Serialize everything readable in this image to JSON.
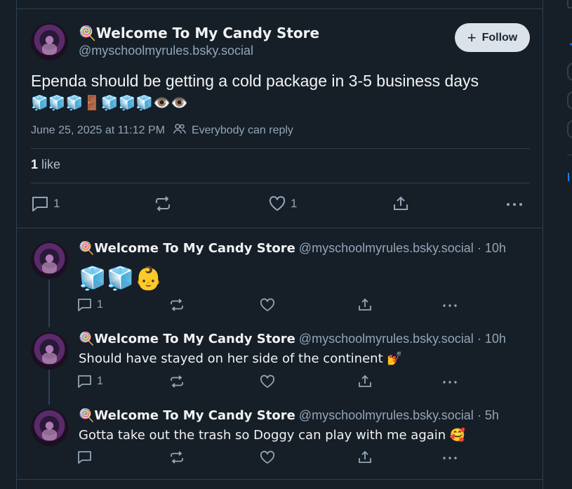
{
  "main_post": {
    "display_name": "🍭Welcome To My Candy Store",
    "handle": "@myschoolmyrules.bsky.social",
    "follow_label": "Follow",
    "text_line1": "Ependa should be getting a cold package in 3-5 business days",
    "text_line2": "🧊🧊🧊🚪🧊🧊🧊👁️👁️",
    "timestamp": "June 25, 2025 at 11:12 PM",
    "reply_setting": "Everybody can reply",
    "like_count": "1",
    "like_word": "like",
    "reply_count": "1",
    "like_action_count": "1"
  },
  "replies": [
    {
      "display_name": "🍭Welcome To My Candy Store",
      "handle": "@myschoolmyrules.bsky.social",
      "time": "· 10h",
      "text": "🧊🧊👶",
      "reply_count": "1"
    },
    {
      "display_name": "🍭Welcome To My Candy Store",
      "handle": "@myschoolmyrules.bsky.social",
      "time": "· 10h",
      "text": "Should have stayed on her side of the continent 💅",
      "reply_count": "1"
    },
    {
      "display_name": "🍭Welcome To My Candy Store",
      "handle": "@myschoolmyrules.bsky.social",
      "time": "· 5h",
      "text": "Gotta take out the trash so Doggy can play with me again 🥰",
      "reply_count": ""
    }
  ],
  "colors": {
    "background": "#161e27",
    "border": "#2e4052",
    "muted_text": "#93a5b7",
    "follow_bg": "#dce2ea"
  },
  "icons": [
    "plus-icon",
    "people-icon",
    "reply-icon",
    "repost-icon",
    "heart-icon",
    "share-icon",
    "more-icon"
  ]
}
